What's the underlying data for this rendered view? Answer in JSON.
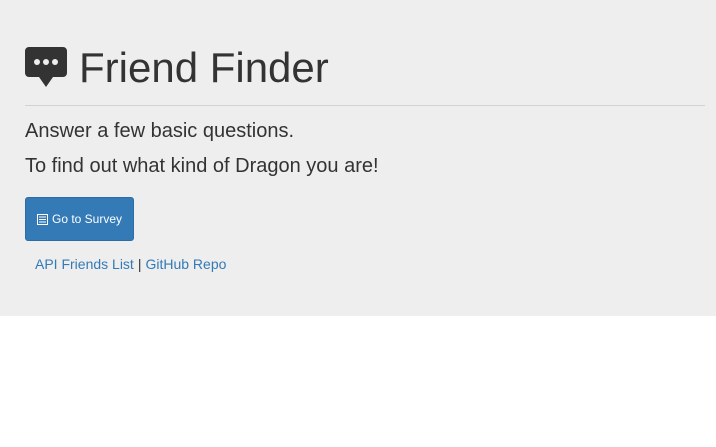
{
  "header": {
    "title": "Friend Finder",
    "icon": "comment-icon"
  },
  "intro": {
    "line1": "Answer a few basic questions.",
    "line2": "To find out what kind of Dragon you are!"
  },
  "actions": {
    "survey_button_label": "Go to Survey",
    "survey_button_icon": "list-alt-icon"
  },
  "footer_links": {
    "api_link": "API Friends List",
    "separator": "|",
    "github_link": "GitHub Repo"
  },
  "colors": {
    "jumbotron_bg": "#eeeeee",
    "primary": "#337ab7",
    "text": "#333333"
  }
}
